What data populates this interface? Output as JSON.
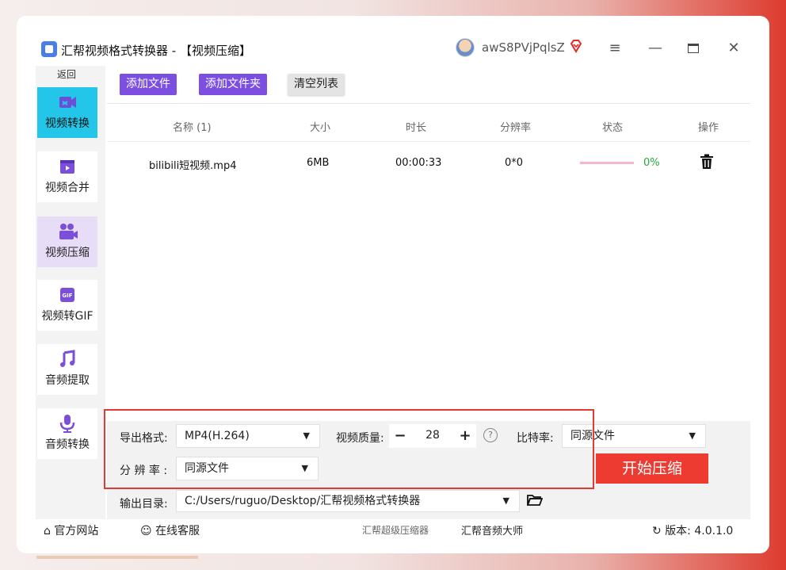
{
  "titlebar": {
    "title": "汇帮视频格式转换器 - 【视频压缩】",
    "username": "awS8PVjPqlsZ",
    "menu_icon": "menu-icon",
    "minimize_icon": "minimize-icon",
    "maximize_icon": "maximize-icon",
    "close_icon": "close-icon"
  },
  "sidebar": {
    "back_label": "返回",
    "items": [
      {
        "label": "视频转换",
        "icon": "video-convert-icon"
      },
      {
        "label": "视频合并",
        "icon": "video-merge-icon"
      },
      {
        "label": "视频压缩",
        "icon": "video-compress-icon"
      },
      {
        "label": "视频转GIF",
        "icon": "gif-icon"
      },
      {
        "label": "音频提取",
        "icon": "music-note-icon"
      },
      {
        "label": "音频转换",
        "icon": "microphone-icon"
      }
    ]
  },
  "toolbar": {
    "add_file": "添加文件",
    "add_folder": "添加文件夹",
    "clear_list": "清空列表"
  },
  "table": {
    "columns": [
      "名称 (1)",
      "大小",
      "时长",
      "分辨率",
      "状态",
      "操作"
    ],
    "rows": [
      {
        "name": "bilibili短视频.mp4",
        "size": "6MB",
        "duration": "00:00:33",
        "resolution": "0*0",
        "progress": "0%"
      }
    ]
  },
  "settings": {
    "format_label": "导出格式:",
    "format_value": "MP4(H.264)",
    "quality_label": "视频质量:",
    "quality_value": "28",
    "minus": "−",
    "plus": "+",
    "help": "?",
    "bitrate_label": "比特率:",
    "bitrate_value": "同源文件",
    "resolution_label": "分 辨 率 :",
    "resolution_value": "同源文件",
    "start_button": "开始压缩",
    "output_label": "输出目录:",
    "output_value": "C:/Users/ruguo/Desktop/汇帮视频格式转换器"
  },
  "footer": {
    "website": "官方网站",
    "support": "在线客服",
    "product1": "汇帮超级压缩器",
    "product2": "汇帮音频大师",
    "version": "版本: 4.0.1.0"
  },
  "colors": {
    "accent_purple": "#7c4fe0",
    "active_blue": "#23c6e8",
    "start_red": "#ee3b32",
    "progress_green": "#22a83c"
  }
}
